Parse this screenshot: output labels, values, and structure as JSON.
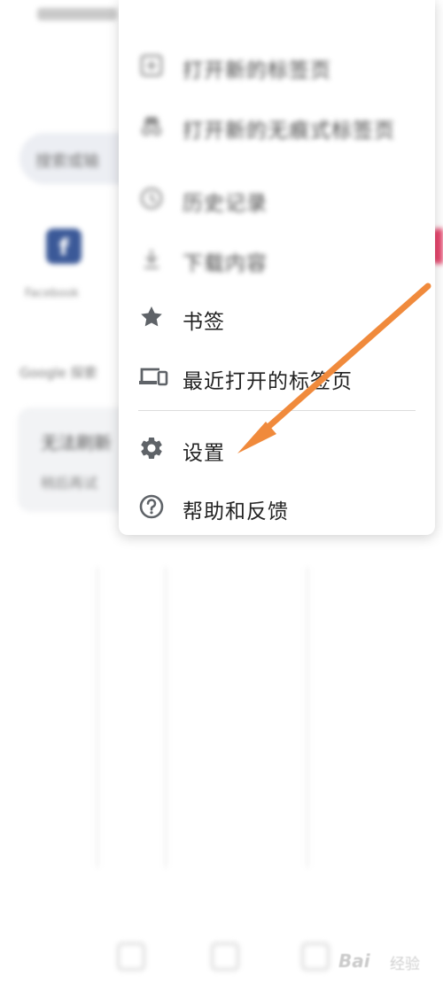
{
  "background": {
    "search_text": "搜索或输",
    "shortcut_label": "Facebook",
    "section_label": "Google 探索",
    "refresh_title": "无法刷新",
    "refresh_sub": "稍后再试"
  },
  "menu": {
    "items": [
      {
        "label": "打开新的标签页",
        "icon": "new-tab-icon",
        "faded": true
      },
      {
        "label": "打开新的无痕式标签页",
        "icon": "incognito-icon",
        "faded": true
      },
      {
        "label": "历史记录",
        "icon": "history-icon",
        "faded": true
      },
      {
        "label": "下载内容",
        "icon": "download-icon",
        "faded": true
      },
      {
        "label": "书签",
        "icon": "star-icon",
        "faded": false
      },
      {
        "label": "最近打开的标签页",
        "icon": "recent-tabs-icon",
        "faded": false
      },
      {
        "label": "设置",
        "icon": "gear-icon",
        "faded": false
      },
      {
        "label": "帮助和反馈",
        "icon": "help-icon",
        "faded": false
      }
    ]
  },
  "annotation": {
    "arrow_color": "#f08a3c"
  },
  "watermark": {
    "brand": "Bai",
    "brand_suffix": "经验"
  },
  "colors": {
    "icon_gray": "#5f6368",
    "facebook_blue": "#3b5998"
  }
}
